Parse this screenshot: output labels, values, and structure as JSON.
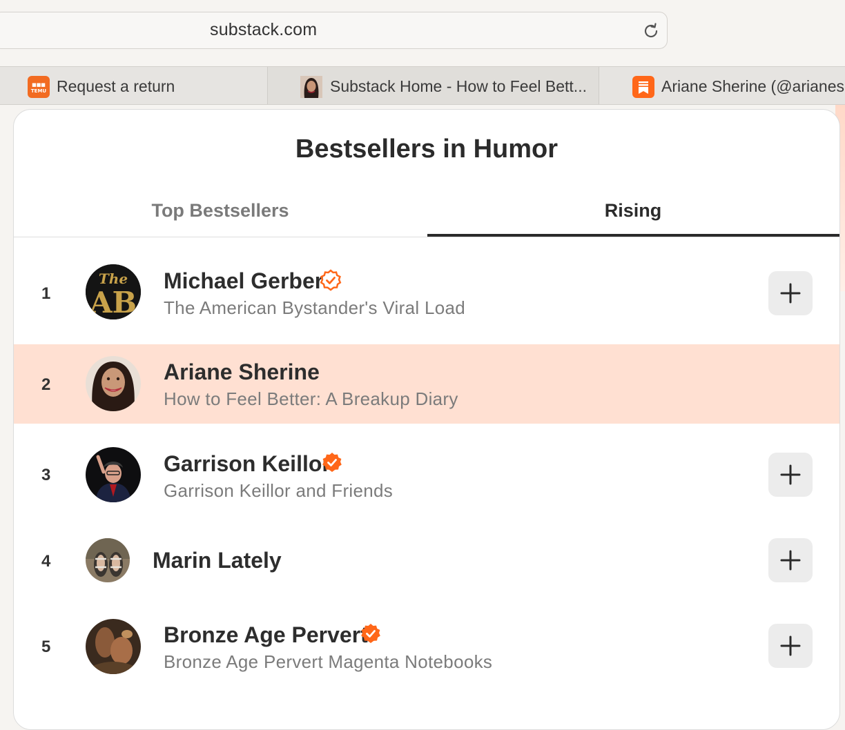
{
  "browser": {
    "url": "substack.com",
    "tabs": [
      {
        "label": "Request a return",
        "icon": "temu-icon"
      },
      {
        "label": "Substack Home - How to Feel Bett...",
        "icon": "avatar-icon"
      },
      {
        "label": "Ariane Sherine (@arianesh",
        "icon": "substack-icon"
      }
    ]
  },
  "page": {
    "title": "Bestsellers in Humor",
    "tabs": [
      "Top Bestsellers",
      "Rising"
    ],
    "active_tab": "Rising"
  },
  "list": [
    {
      "rank": "1",
      "name": "Michael Gerber",
      "publication": "The American Bystander's Viral Load",
      "verified": true,
      "badge": "outline",
      "subscribe": true
    },
    {
      "rank": "2",
      "name": "Ariane Sherine",
      "publication": "How to Feel Better: A Breakup Diary",
      "verified": false,
      "subscribe": false,
      "highlighted": true
    },
    {
      "rank": "3",
      "name": "Garrison Keillor",
      "publication": "Garrison Keillor and Friends",
      "verified": true,
      "badge": "filled",
      "subscribe": true
    },
    {
      "rank": "4",
      "name": "Marin Lately",
      "publication": "",
      "verified": false,
      "subscribe": true
    },
    {
      "rank": "5",
      "name": "Bronze Age Pervert",
      "publication": "Bronze Age Pervert Magenta Notebooks",
      "verified": true,
      "badge": "filled",
      "subscribe": true
    }
  ],
  "colors": {
    "accent": "#ff6719",
    "highlight_row": "#ffe0d2",
    "button_bg": "#ececec"
  }
}
